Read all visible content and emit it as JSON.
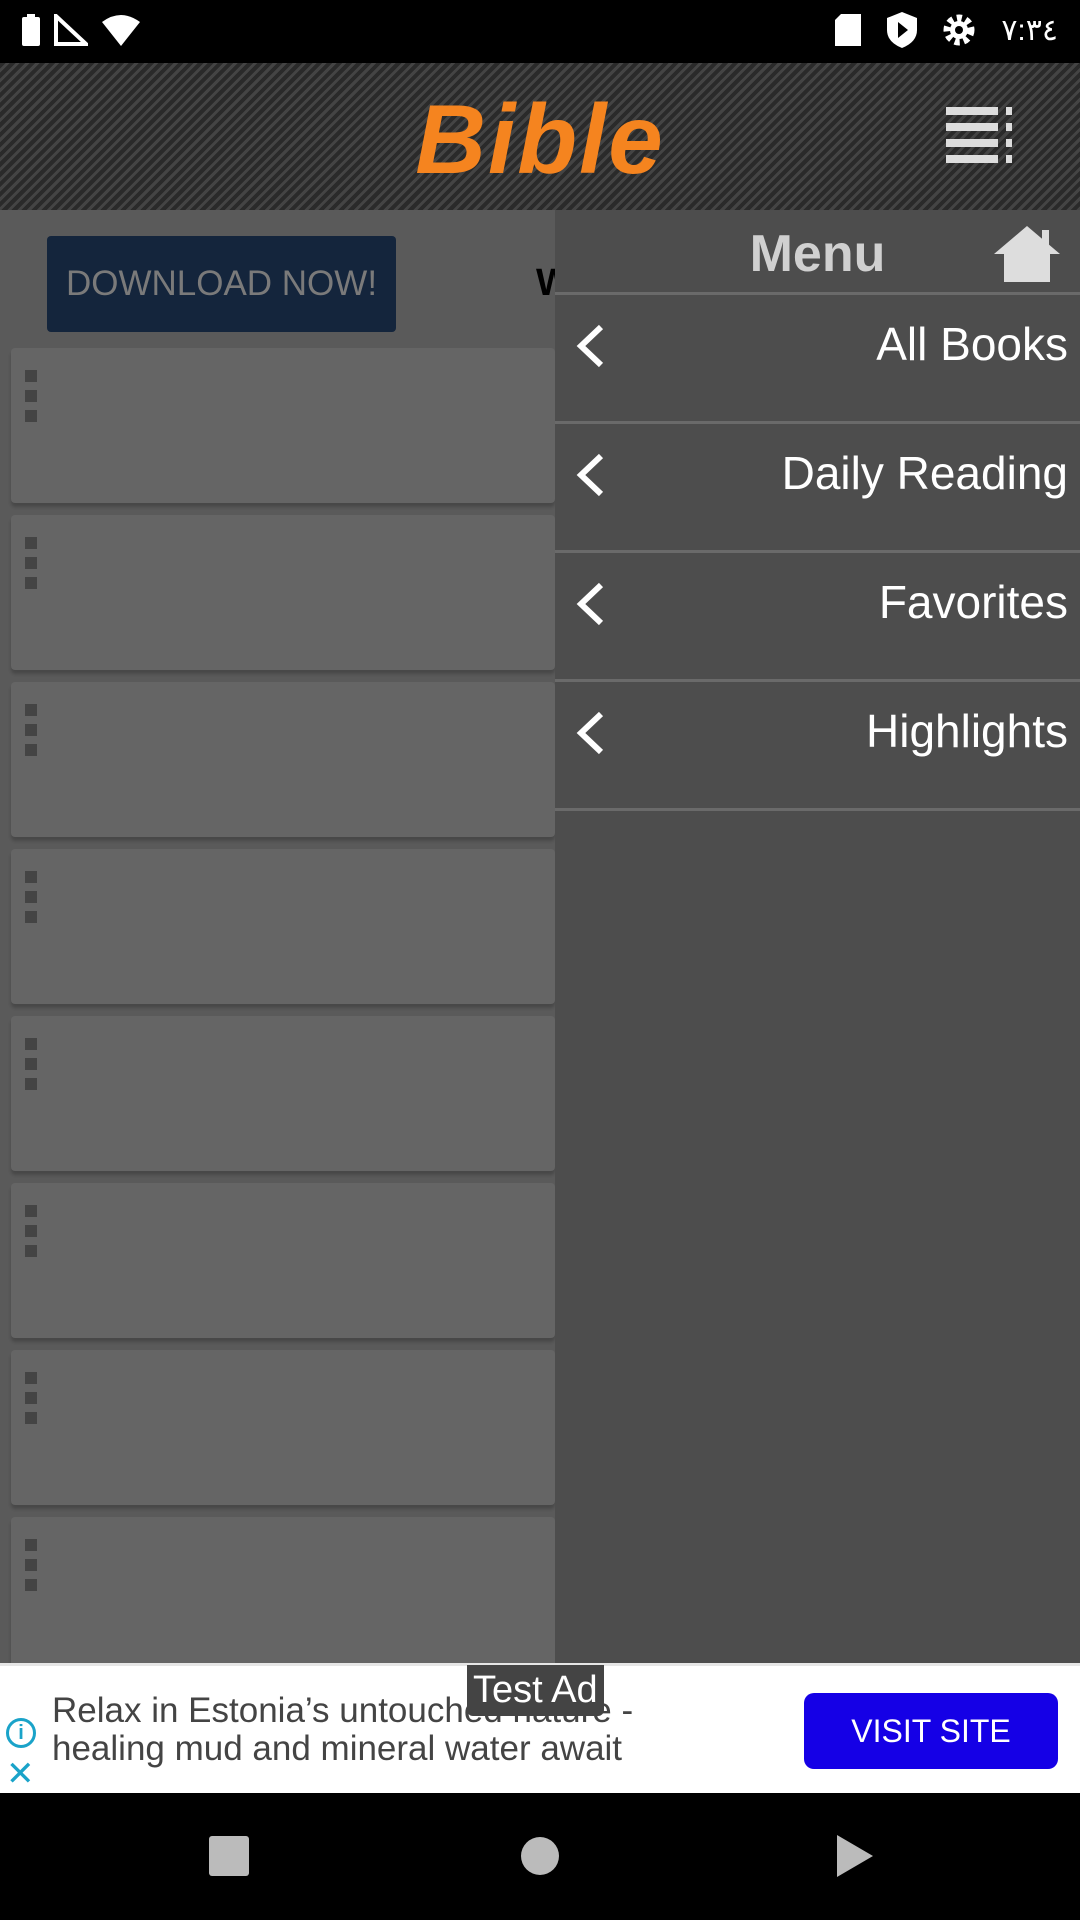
{
  "status_bar": {
    "time": "٧:٣٤",
    "icons": [
      "battery-icon",
      "signal-icon",
      "wifi-icon",
      "sd-card-icon",
      "shield-play-icon",
      "settings-icon"
    ]
  },
  "header": {
    "title": "Bible",
    "title_color": "#f5841f",
    "menu_icon": "list-menu-icon"
  },
  "content": {
    "download_label": "DOWNLOAD NOW!",
    "partial_text": "W",
    "card_count": 8
  },
  "drawer": {
    "title": "Menu",
    "home_icon": "home-icon",
    "items": [
      {
        "label": "All Books"
      },
      {
        "label": "Daily Reading"
      },
      {
        "label": "Favorites"
      },
      {
        "label": "Highlights"
      }
    ]
  },
  "ad": {
    "badge": "Test Ad",
    "text": "Relax in Estonia’s untouched nature - healing mud and mineral water await",
    "cta": "VISIT SITE",
    "cta_color": "#1500e6"
  },
  "nav_bar": {
    "buttons": [
      "recents-icon",
      "home-circle-icon",
      "back-icon"
    ]
  }
}
